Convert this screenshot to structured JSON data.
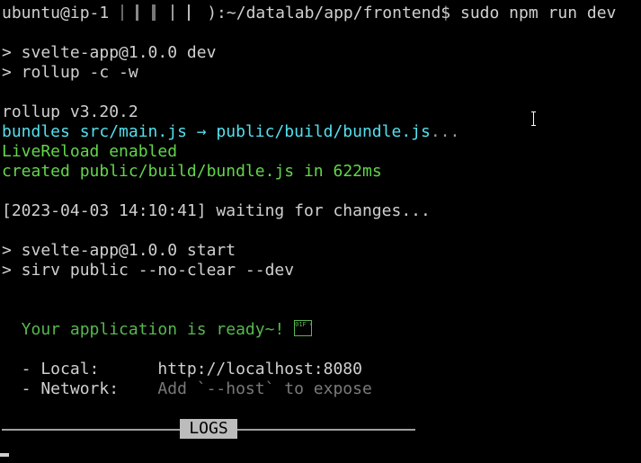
{
  "prompt": {
    "user_host_prefix": "ubuntu@ip-1",
    "path_suffix": "):~/datalab/app/frontend$ ",
    "command": "sudo npm run dev"
  },
  "npm": {
    "dev_header": "> svelte-app@1.0.0 dev",
    "dev_script": "> rollup -c -w",
    "start_header": "> svelte-app@1.0.0 start",
    "start_script": "> sirv public --no-clear --dev"
  },
  "rollup": {
    "version_line": "rollup v3.20.2",
    "bundles_word": "bundles ",
    "bundles_paths": "src/main.js → public/build/bundle.js",
    "bundles_ellipsis": "...",
    "livereload": "LiveReload enabled",
    "created_word": "created ",
    "created_path": "public/build/bundle.js",
    "created_in": " in ",
    "created_time": "622ms",
    "waiting": "[2023-04-03 14:10:41] waiting for changes..."
  },
  "sirv": {
    "ready_text": "  Your application is ready~! ",
    "ready_glyph": "01F 680",
    "local_label": "  - Local:      ",
    "local_value": "http://localhost:8080",
    "network_label": "  - Network:    ",
    "network_value": "Add `--host` to expose"
  },
  "status_bar": {
    "label": "LOGS"
  },
  "colors": {
    "background": "#000000",
    "text": "#d0d0d0",
    "cyan": "#54e0ee",
    "green": "#62d64a",
    "ready_green": "#56b84e"
  }
}
